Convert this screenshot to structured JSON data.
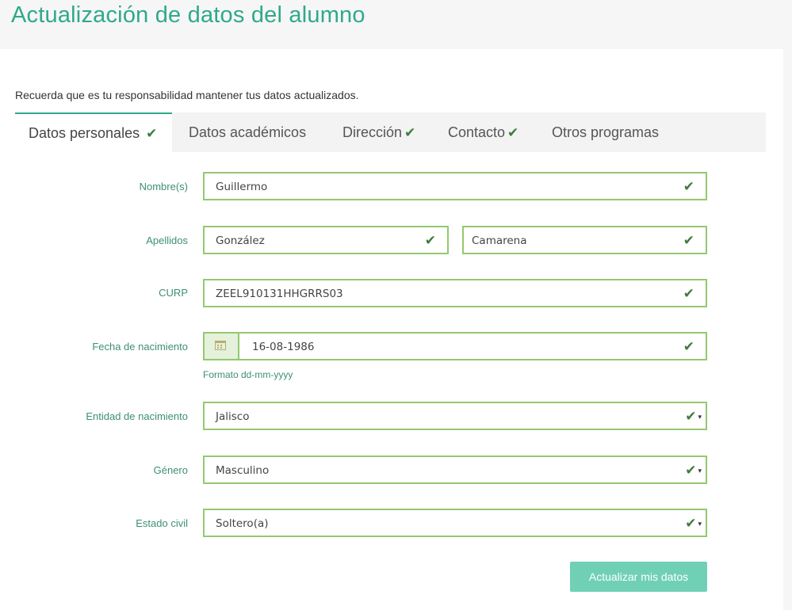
{
  "header": {
    "title": "Actualización de datos del alumno"
  },
  "intro": "Recuerda que es tu responsabilidad mantener tus datos actualizados.",
  "tabs": [
    {
      "label": "Datos personales",
      "checked": true,
      "active": true
    },
    {
      "label": "Datos académicos",
      "checked": false,
      "active": false
    },
    {
      "label": "Dirección",
      "checked": true,
      "active": false
    },
    {
      "label": "Contacto",
      "checked": true,
      "active": false
    },
    {
      "label": "Otros programas",
      "checked": false,
      "active": false
    }
  ],
  "check_glyph": "✔",
  "caret_glyph": "▾",
  "form": {
    "nombre": {
      "label": "Nombre(s)",
      "value": "Guillermo"
    },
    "apellidos": {
      "label": "Apellidos",
      "value1": "González",
      "value2": "Camarena"
    },
    "curp": {
      "label": "CURP",
      "value": "ZEEL910131HHGRRS03"
    },
    "fecha": {
      "label": "Fecha de nacimiento",
      "value": "16-08-1986",
      "hint": "Formato dd-mm-yyyy"
    },
    "entidad": {
      "label": "Entidad de nacimiento",
      "value": "Jalisco"
    },
    "genero": {
      "label": "Género",
      "value": "Masculino"
    },
    "estado_civil": {
      "label": "Estado civil",
      "value": "Soltero(a)"
    }
  },
  "submit_label": "Actualizar mis datos",
  "colors": {
    "accent": "#2fa98a",
    "field_border": "#93c96f",
    "check": "#3c7d3c",
    "button": "#6fd0b6"
  }
}
